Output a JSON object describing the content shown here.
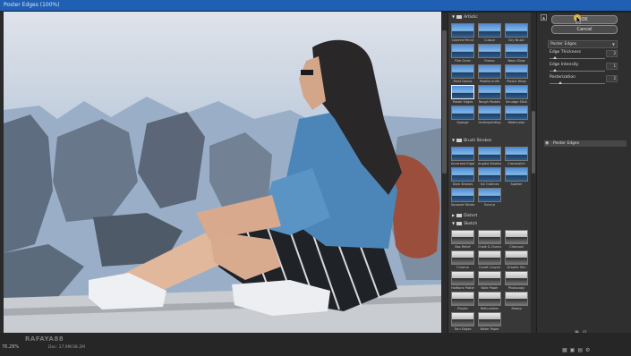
{
  "window": {
    "title": "Poster Edges (100%)"
  },
  "statusbar": {
    "zoom": "76.29%",
    "doc": "Doc: 17.9M/38.2M",
    "watermark": "RAFAYA88"
  },
  "gallery": {
    "categories": [
      {
        "name": "Artistic",
        "expanded": true,
        "folder": true
      },
      {
        "name": "Brush Strokes",
        "expanded": true,
        "folder": true
      },
      {
        "name": "Distort",
        "expanded": false,
        "folder": true
      },
      {
        "name": "Sketch",
        "expanded": true,
        "folder": true
      }
    ],
    "artistic": [
      "Colored Pencil",
      "Cutout",
      "Dry Brush",
      "Film Grain",
      "Fresco",
      "Neon Glow",
      "Paint Daubs",
      "Palette Knife",
      "Plastic Wrap",
      "Poster Edges",
      "Rough Pastels",
      "Smudge Stick",
      "Sponge",
      "Underpainting",
      "Watercolor"
    ],
    "brush": [
      "Accented Edges",
      "Angled Strokes",
      "Crosshatch",
      "Dark Strokes",
      "Ink Outlines",
      "Spatter",
      "Sprayed Strokes",
      "Sumi-e"
    ],
    "sketch": [
      "Bas Relief",
      "Chalk & Charcoal",
      "Charcoal",
      "Chrome",
      "Conté Crayon",
      "Graphic Pen",
      "Halftone Pattern",
      "Note Paper",
      "Photocopy",
      "Plaster",
      "Reticulation",
      "Stamp",
      "Torn Edges",
      "Water Paper"
    ]
  },
  "panel": {
    "ok_label": "OK",
    "cancel_label": "Cancel",
    "filter_select": "Poster Edges",
    "params": [
      {
        "label": "Edge Thickness",
        "value": "2",
        "level": 0.1
      },
      {
        "label": "Edge Intensity",
        "value": "1",
        "level": 0.1
      },
      {
        "label": "Posterization",
        "value": "2",
        "level": 0.2
      }
    ],
    "layer_name": "Poster Edges"
  }
}
